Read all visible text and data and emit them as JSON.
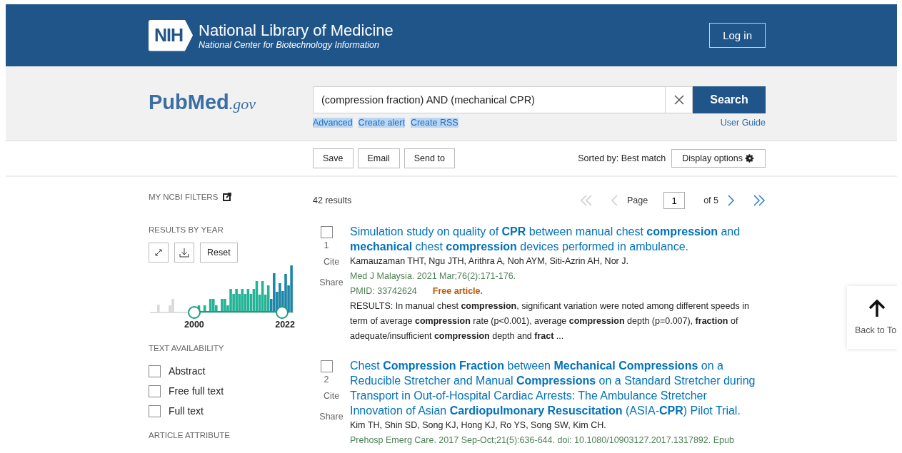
{
  "header": {
    "logo_text": "NIH",
    "title": "National Library of Medicine",
    "subtitle": "National Center for Biotechnology Information",
    "login": "Log in"
  },
  "search": {
    "logo": {
      "first": "Pub",
      "second": "Med",
      "suffix": ".gov"
    },
    "query": "(compression fraction) AND (mechanical CPR)",
    "button": "Search",
    "links": [
      "Advanced",
      "Create alert",
      "Create RSS"
    ],
    "user_guide": "User Guide"
  },
  "toolbar": {
    "buttons": [
      "Save",
      "Email",
      "Send to"
    ],
    "sorted_by": "Sorted by: Best match",
    "display_options": "Display options"
  },
  "sidebar": {
    "my_filters": "MY NCBI FILTERS",
    "results_by_year": {
      "title": "RESULTS BY YEAR",
      "reset": "Reset",
      "start_year": "2000",
      "end_year": "2022"
    },
    "text_availability": {
      "title": "TEXT AVAILABILITY",
      "options": [
        {
          "label": "Abstract",
          "checked": false
        },
        {
          "label": "Free full text",
          "checked": false
        },
        {
          "label": "Full text",
          "checked": false
        }
      ]
    },
    "article_attribute": {
      "title": "ARTICLE ATTRIBUTE"
    }
  },
  "results": {
    "count": "42 results",
    "pagination": {
      "page_label": "Page",
      "page": "1",
      "of": "of 5"
    },
    "items": [
      {
        "number": "1",
        "checked": false,
        "cite": "Cite",
        "share": "Share",
        "title": "Simulation study on quality of **CPR** between manual chest **compression** and **mechanical** chest **compression** devices performed in ambulance.",
        "authors": "Kamauzaman THT, Ngu JTH, Arithra A, Noh AYM, Siti-Azrin AH, Nor J.",
        "citation": "Med J Malaysia. 2021 Mar;76(2):171-176.",
        "pmid": "PMID: 33742624",
        "free": "Free article.",
        "snippet": "RESULTS: In manual chest **compression**, significant variation were noted among different speeds in term of average **compression** rate (p<0.001), average **compression** depth (p=0.007), **fraction** of adequate/insufficient **compression** depth and **fract** ..."
      },
      {
        "number": "2",
        "checked": false,
        "cite": "Cite",
        "share": "Share",
        "title": "Chest **Compression Fraction** between **Mechanical Compressions** on a Reducible Stretcher and Manual **Compressions** on a Standard Stretcher during Transport in Out-of-Hospital Cardiac Arrests: The Ambulance Stretcher Innovation of Asian **Cardiopulmonary Resuscitation** (ASIA-**CPR**) Pilot Trial.",
        "authors": "Kim TH, Shin SD, Song KJ, Hong KJ, Ro YS, Song SW, Kim CH.",
        "citation": "Prehosp Emerg Care. 2017 Sep-Oct;21(5):636-644. doi: 10.1080/10903127.2017.1317892. Epub"
      }
    ]
  },
  "back_to_top": "Back to To"
}
